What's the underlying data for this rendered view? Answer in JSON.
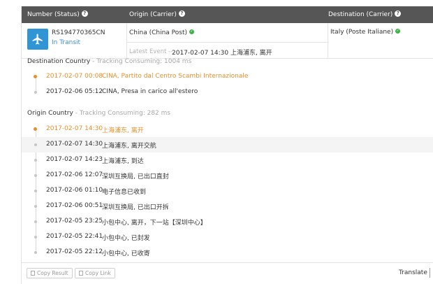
{
  "header": {
    "number_label": "Number (Status)",
    "origin_label": "Origin (Carrier)",
    "destination_label": "Destination (Carrier)"
  },
  "summary": {
    "tracking_number": "RS194770365CN",
    "status": "In Transit",
    "origin_carrier": "China (China Post)",
    "destination_carrier": "Italy (Poste Italiane)",
    "latest_event_label": "Latest Event --",
    "latest_event": "2017-02-07 14:30 上海浦东, 离开"
  },
  "destination_section": {
    "title": "Destination Country",
    "consuming": "- Tracking Consuming: 1004 ms",
    "events": [
      {
        "time": "2017-02-07 00:08",
        "desc": "CINA, Partito dal Centro Scambi Internazionale"
      },
      {
        "time": "2017-02-06 05:12",
        "desc": "CINA, Presa in carico all'estero"
      }
    ]
  },
  "origin_section": {
    "title": "Origin Country",
    "consuming": "- Tracking Consuming: 282 ms",
    "events": [
      {
        "time": "2017-02-07 14:30",
        "desc": "上海浦东, 离开"
      },
      {
        "time": "2017-02-07 14:30",
        "desc": "上海浦东, 离开交航"
      },
      {
        "time": "2017-02-07 14:23",
        "desc": "上海浦东, 到达"
      },
      {
        "time": "2017-02-06 12:07",
        "desc": "深圳互换局, 已出口直封"
      },
      {
        "time": "2017-02-06 01:10",
        "desc": "电子信息已收到"
      },
      {
        "time": "2017-02-06 00:51",
        "desc": "深圳互换局, 已出口开拆"
      },
      {
        "time": "2017-02-05 23:25",
        "desc": "小包中心, 离开，下一站【深圳中心】"
      },
      {
        "time": "2017-02-05 22:41",
        "desc": "小包中心, 已封发"
      },
      {
        "time": "2017-02-05 22:12",
        "desc": "小包中心, 已收寄"
      }
    ]
  },
  "footer": {
    "copy_result": "Copy Result",
    "copy_link": "Copy Link",
    "translate": "Translate"
  },
  "colors": {
    "header_bg": "#565656",
    "accent_blue": "#2f95d5",
    "latest_orange": "#e88f2b",
    "carrier_ok_green": "#3fb24a"
  },
  "icons": {
    "status": "airplane-icon",
    "help": "question-circle-icon",
    "carrier_ok": "check-circle-icon",
    "copy": "copy-icon"
  }
}
